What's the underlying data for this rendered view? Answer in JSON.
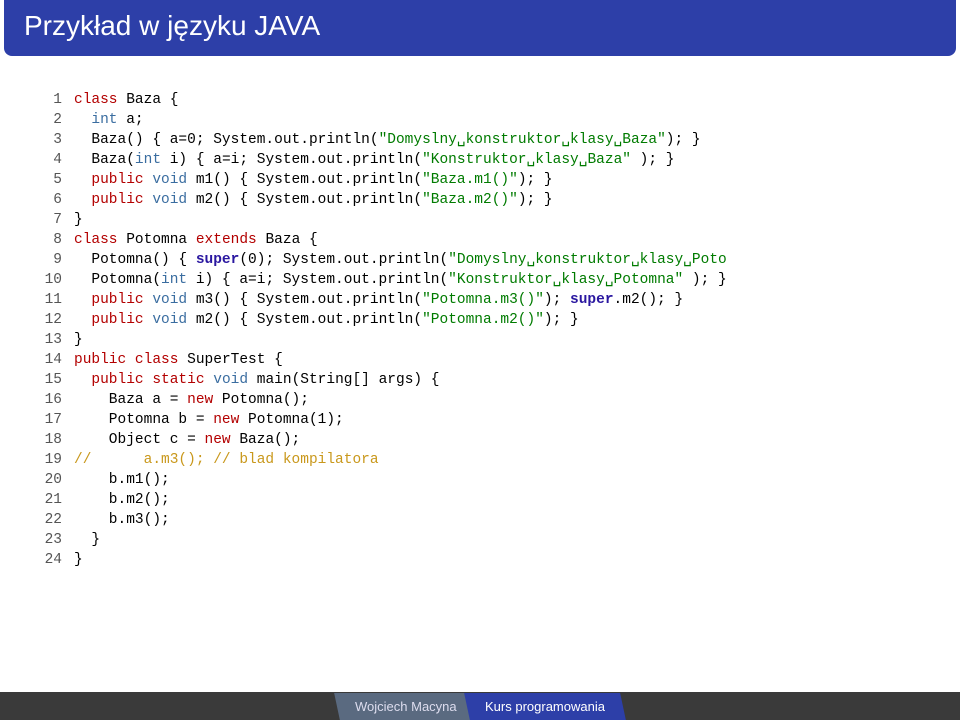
{
  "title": "Przykład w języku JAVA",
  "footer": {
    "author": "Wojciech Macyna",
    "course": "Kurs programowania"
  },
  "code": [
    {
      "n": 1,
      "tokens": [
        [
          "class",
          "c0"
        ],
        [
          " Baza {",
          ""
        ]
      ]
    },
    {
      "n": 2,
      "tokens": [
        [
          "  ",
          ""
        ],
        [
          "int",
          "c1"
        ],
        [
          " a;",
          ""
        ]
      ]
    },
    {
      "n": 3,
      "tokens": [
        [
          "  Baza() { a=0; System.out.println(",
          ""
        ],
        [
          "\"Domyslny␣konstruktor␣klasy␣Baza\"",
          "c2"
        ],
        [
          "); }",
          ""
        ]
      ]
    },
    {
      "n": 4,
      "tokens": [
        [
          "  Baza(",
          ""
        ],
        [
          "int",
          "c1"
        ],
        [
          " i) { a=i; System.out.println(",
          ""
        ],
        [
          "\"Konstruktor␣klasy␣Baza\"",
          "c2"
        ],
        [
          " ); }",
          ""
        ]
      ]
    },
    {
      "n": 5,
      "tokens": [
        [
          "  ",
          ""
        ],
        [
          "public",
          "c0"
        ],
        [
          " ",
          ""
        ],
        [
          "void",
          "c1"
        ],
        [
          " m1() { System.out.println(",
          ""
        ],
        [
          "\"Baza.m1()\"",
          "c2"
        ],
        [
          "); }",
          ""
        ]
      ]
    },
    {
      "n": 6,
      "tokens": [
        [
          "  ",
          ""
        ],
        [
          "public",
          "c0"
        ],
        [
          " ",
          ""
        ],
        [
          "void",
          "c1"
        ],
        [
          " m2() { System.out.println(",
          ""
        ],
        [
          "\"Baza.m2()\"",
          "c2"
        ],
        [
          "); }",
          ""
        ]
      ]
    },
    {
      "n": 7,
      "tokens": [
        [
          "}",
          ""
        ]
      ]
    },
    {
      "n": 8,
      "tokens": [
        [
          "class",
          "c0"
        ],
        [
          " Potomna ",
          ""
        ],
        [
          "extends",
          "c0"
        ],
        [
          " Baza {",
          ""
        ]
      ]
    },
    {
      "n": 9,
      "tokens": [
        [
          "  Potomna() { ",
          ""
        ],
        [
          "super",
          "c3"
        ],
        [
          "(0); System.out.println(",
          ""
        ],
        [
          "\"Domyslny␣konstruktor␣klasy␣Poto",
          "c2"
        ]
      ]
    },
    {
      "n": 10,
      "tokens": [
        [
          "  Potomna(",
          ""
        ],
        [
          "int",
          "c1"
        ],
        [
          " i) { a=i; System.out.println(",
          ""
        ],
        [
          "\"Konstruktor␣klasy␣Potomna\"",
          "c2"
        ],
        [
          " ); }",
          ""
        ]
      ]
    },
    {
      "n": 11,
      "tokens": [
        [
          "  ",
          ""
        ],
        [
          "public",
          "c0"
        ],
        [
          " ",
          ""
        ],
        [
          "void",
          "c1"
        ],
        [
          " m3() { System.out.println(",
          ""
        ],
        [
          "\"Potomna.m3()\"",
          "c2"
        ],
        [
          "); ",
          ""
        ],
        [
          "super",
          "c3"
        ],
        [
          ".m2(); }",
          ""
        ]
      ]
    },
    {
      "n": 12,
      "tokens": [
        [
          "  ",
          ""
        ],
        [
          "public",
          "c0"
        ],
        [
          " ",
          ""
        ],
        [
          "void",
          "c1"
        ],
        [
          " m2() { System.out.println(",
          ""
        ],
        [
          "\"Potomna.m2()\"",
          "c2"
        ],
        [
          "); }",
          ""
        ]
      ]
    },
    {
      "n": 13,
      "tokens": [
        [
          "}",
          ""
        ]
      ]
    },
    {
      "n": 14,
      "tokens": [
        [
          "public",
          "c0"
        ],
        [
          " ",
          ""
        ],
        [
          "class",
          "c0"
        ],
        [
          " SuperTest {",
          ""
        ]
      ]
    },
    {
      "n": 15,
      "tokens": [
        [
          "  ",
          ""
        ],
        [
          "public",
          "c0"
        ],
        [
          " ",
          ""
        ],
        [
          "static",
          "c0"
        ],
        [
          " ",
          ""
        ],
        [
          "void",
          "c1"
        ],
        [
          " main(String[] args) {",
          ""
        ]
      ]
    },
    {
      "n": 16,
      "tokens": [
        [
          "    Baza a = ",
          ""
        ],
        [
          "new",
          "c0"
        ],
        [
          " Potomna();",
          ""
        ]
      ]
    },
    {
      "n": 17,
      "tokens": [
        [
          "    Potomna b = ",
          ""
        ],
        [
          "new",
          "c0"
        ],
        [
          " Potomna(1);",
          ""
        ]
      ]
    },
    {
      "n": 18,
      "tokens": [
        [
          "    Object c = ",
          ""
        ],
        [
          "new",
          "c0"
        ],
        [
          " Baza();",
          ""
        ]
      ]
    },
    {
      "n": 19,
      "tokens": [
        [
          "//      a.m3(); // blad kompilatora",
          "c4"
        ]
      ]
    },
    {
      "n": 20,
      "tokens": [
        [
          "    b.m1();",
          ""
        ]
      ]
    },
    {
      "n": 21,
      "tokens": [
        [
          "    b.m2();",
          ""
        ]
      ]
    },
    {
      "n": 22,
      "tokens": [
        [
          "    b.m3();",
          ""
        ]
      ]
    },
    {
      "n": 23,
      "tokens": [
        [
          "  }",
          ""
        ]
      ]
    },
    {
      "n": 24,
      "tokens": [
        [
          "}",
          ""
        ]
      ]
    }
  ]
}
